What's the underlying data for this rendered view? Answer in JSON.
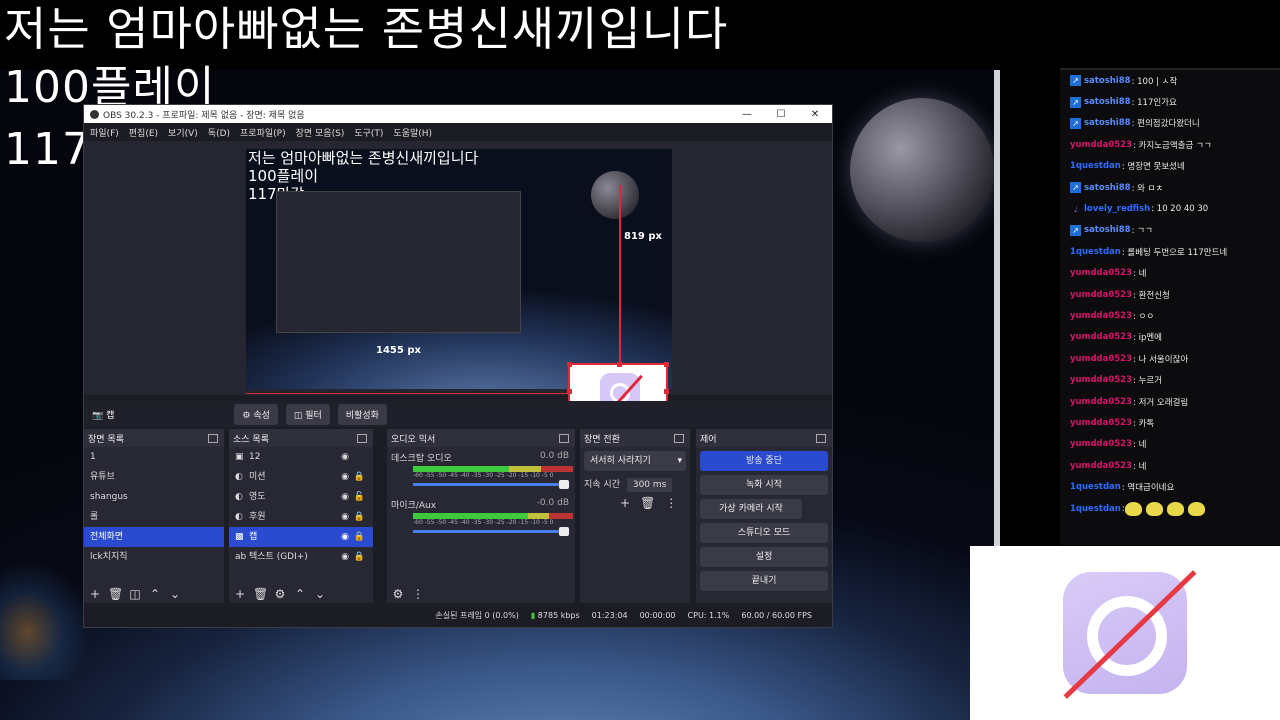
{
  "overlay": {
    "line1": "저는 엄마아빠없는 존병신새끼입니다",
    "line2": "100플레이",
    "line3": "117마감"
  },
  "obs": {
    "title": "OBS 30.2.3 - 프로파일: 제목 없음 - 장면: 제목 없음",
    "menu": [
      "파일(F)",
      "편집(E)",
      "보기(V)",
      "독(D)",
      "프로파일(P)",
      "장면 모음(S)",
      "도구(T)",
      "도움말(H)"
    ],
    "preview_text": {
      "l1": "저는 엄마아빠없는 존병신새끼입니다",
      "l2": "100플레이",
      "l3": "117마감",
      "px_a": "819 px",
      "px_b": "1455 px"
    },
    "source_label": "캡",
    "buttons": {
      "properties": "속성",
      "filters": "필터",
      "deactivate": "비활성화"
    },
    "docks": {
      "scenes_title": "장면 목록",
      "scenes": [
        "1",
        "유튜브",
        "shangus",
        "롤",
        "전체화면",
        "lck치지직"
      ],
      "sources_title": "소스 목록",
      "sources": [
        "12",
        "미션",
        "영도",
        "후원",
        "캡",
        "텍스트 (GDI+)"
      ],
      "mixer_title": "오디오 믹서",
      "mixer": [
        {
          "name": "데스크탑 오디오",
          "level": "0.0 dB"
        },
        {
          "name": "마이크/Aux",
          "level": "-0.0 dB"
        }
      ],
      "meter_scale": "-60 -55 -50 -45 -40 -35 -30 -25 -20 -15 -10 -5 0",
      "transition_title": "장면 전환",
      "transition_select": "서서히 사라지기",
      "duration_label": "지속 시간",
      "duration_value": "300 ms",
      "controls_title": "제어",
      "controls": [
        "방송 중단",
        "녹화 시작",
        "가상 카메라 시작",
        "스튜디오 모드",
        "설정",
        "끝내기"
      ]
    },
    "status": {
      "dropped": "손실된 프레임 0 (0.0%)",
      "bitrate": "8785 kbps",
      "live_time": "01:23:04",
      "rec_time": "00:00:00",
      "cpu": "CPU: 1.1%",
      "fps": "60.00 / 60.00 FPS"
    }
  },
  "chat": [
    {
      "user": "satoshi88",
      "color": "#5a8cff",
      "badge": "sword",
      "msg": ": 100 | ㅅ작"
    },
    {
      "user": "satoshi88",
      "color": "#5a8cff",
      "badge": "sword",
      "msg": ": 117인가요"
    },
    {
      "user": "satoshi88",
      "color": "#5a8cff",
      "badge": "sword",
      "msg": ": 편의점갔다왔더니"
    },
    {
      "user": "yumdda0523",
      "color": "#d6156b",
      "badge": "",
      "msg": ": 카지노금액출금 ㄱㄱ"
    },
    {
      "user": "1questdan",
      "color": "#2f6cff",
      "badge": "",
      "msg": ": 명장면 못보셨네"
    },
    {
      "user": "satoshi88",
      "color": "#5a8cff",
      "badge": "sword",
      "msg": ": 와 ㅁㅊ"
    },
    {
      "user": "lovely_redfish",
      "color": "#2f6cff",
      "badge": "mic",
      "msg": ": 10 20 40 30"
    },
    {
      "user": "satoshi88",
      "color": "#5a8cff",
      "badge": "sword",
      "msg": ": ㄱㄱ"
    },
    {
      "user": "1questdan",
      "color": "#2f6cff",
      "badge": "",
      "msg": ": 롤베팅 두번으로 117만드네"
    },
    {
      "user": "yumdda0523",
      "color": "#d6156b",
      "badge": "",
      "msg": ": 네"
    },
    {
      "user": "yumdda0523",
      "color": "#d6156b",
      "badge": "",
      "msg": ": 환전신청"
    },
    {
      "user": "yumdda0523",
      "color": "#d6156b",
      "badge": "",
      "msg": ": ㅇㅇ"
    },
    {
      "user": "yumdda0523",
      "color": "#d6156b",
      "badge": "",
      "msg": ": ip멘에"
    },
    {
      "user": "yumdda0523",
      "color": "#d6156b",
      "badge": "",
      "msg": ": 나 서울이잖아"
    },
    {
      "user": "yumdda0523",
      "color": "#d6156b",
      "badge": "",
      "msg": ": 누르거"
    },
    {
      "user": "yumdda0523",
      "color": "#d6156b",
      "badge": "",
      "msg": ": 저거 오래걸림"
    },
    {
      "user": "yumdda0523",
      "color": "#d6156b",
      "badge": "",
      "msg": ": 카톡"
    },
    {
      "user": "yumdda0523",
      "color": "#d6156b",
      "badge": "",
      "msg": ": 네"
    },
    {
      "user": "yumdda0523",
      "color": "#d6156b",
      "badge": "",
      "msg": ": 네"
    },
    {
      "user": "1questdan",
      "color": "#2f6cff",
      "badge": "",
      "msg": ": 역대급이네요"
    },
    {
      "user": "1questdan",
      "color": "#2f6cff",
      "badge": "",
      "msg": ":"
    }
  ]
}
